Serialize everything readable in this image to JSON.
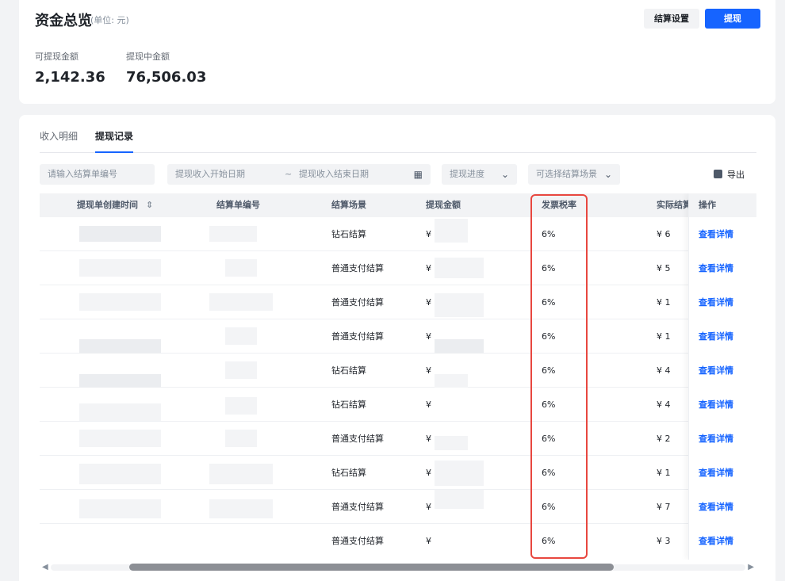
{
  "overview": {
    "title": "资金总览",
    "unit": "(单位: 元)",
    "settle_button": "结算设置",
    "withdraw_button": "提现",
    "available_label": "可提现金额",
    "available_value": "2,142.36",
    "pending_label": "提现中金额",
    "pending_value": "76,506.03"
  },
  "tabs": [
    {
      "label": "收入明细",
      "active": false
    },
    {
      "label": "提现记录",
      "active": true
    }
  ],
  "filters": {
    "order_placeholder": "请输入结算单编号",
    "start_date_placeholder": "提现收入开始日期",
    "date_sep": "~",
    "end_date_placeholder": "提现收入结束日期",
    "progress_placeholder": "提现进度",
    "scene_placeholder": "可选择结算场景",
    "export_label": "导出"
  },
  "table": {
    "headers": {
      "created_time": "提现单创建时间",
      "order_no": "结算单编号",
      "scene": "结算场景",
      "amount": "提现金额",
      "tax_rate": "发票税率",
      "actual": "实际结算",
      "ops": "操作"
    },
    "rows": [
      {
        "scene": "钻石结算",
        "amount": "¥",
        "tax_rate": "6%",
        "actual": "¥ 6",
        "op": "查看详情"
      },
      {
        "scene": "普通支付结算",
        "amount": "¥",
        "tax_rate": "6%",
        "actual": "¥ 5",
        "op": "查看详情"
      },
      {
        "scene": "普通支付结算",
        "amount": "¥",
        "tax_rate": "6%",
        "actual": "¥ 1",
        "op": "查看详情"
      },
      {
        "scene": "普通支付结算",
        "amount": "¥",
        "tax_rate": "6%",
        "actual": "¥ 1",
        "op": "查看详情"
      },
      {
        "scene": "钻石结算",
        "amount": "¥",
        "tax_rate": "6%",
        "actual": "¥ 4",
        "op": "查看详情"
      },
      {
        "scene": "钻石结算",
        "amount": "¥",
        "tax_rate": "6%",
        "actual": "¥ 4",
        "op": "查看详情"
      },
      {
        "scene": "普通支付结算",
        "amount": "¥",
        "tax_rate": "6%",
        "actual": "¥ 2",
        "op": "查看详情"
      },
      {
        "scene": "钻石结算",
        "amount": "¥",
        "tax_rate": "6%",
        "actual": "¥ 1",
        "op": "查看详情"
      },
      {
        "scene": "普通支付结算",
        "amount": "¥",
        "tax_rate": "6%",
        "actual": "¥ 7",
        "op": "查看详情"
      },
      {
        "scene": "普通支付结算",
        "amount": "¥",
        "tax_rate": "6%",
        "actual": "¥ 3",
        "op": "查看详情"
      }
    ]
  },
  "colors": {
    "accent": "#1664ff",
    "highlight": "#e8473f"
  }
}
